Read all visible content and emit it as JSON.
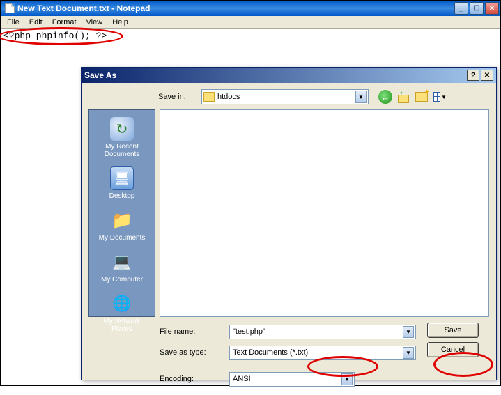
{
  "notepad": {
    "title": "New Text Document.txt - Notepad",
    "menu": {
      "file": "File",
      "edit": "Edit",
      "format": "Format",
      "view": "View",
      "help": "Help"
    },
    "content": "<?php phpinfo(); ?>"
  },
  "dialog": {
    "title": "Save As",
    "savein_label": "Save in:",
    "savein_value": "htdocs",
    "places": {
      "recent": "My Recent Documents",
      "desktop": "Desktop",
      "mydocs": "My Documents",
      "mycomp": "My Computer",
      "network": "My Network Places"
    },
    "filename_label": "File name:",
    "filename_value": "\"test.php\"",
    "saveastype_label": "Save as type:",
    "saveastype_value": "Text Documents (*.txt)",
    "encoding_label": "Encoding:",
    "encoding_value": "ANSI",
    "save_btn": "Save",
    "cancel_btn": "Cancel"
  }
}
